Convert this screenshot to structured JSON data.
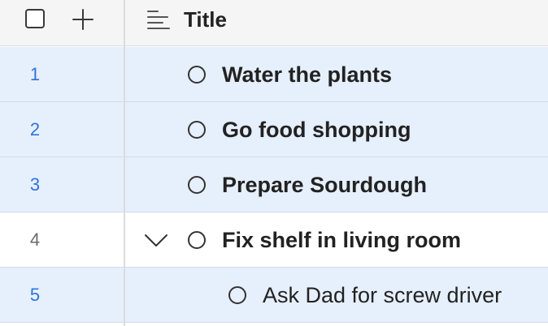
{
  "header": {
    "title": "Title",
    "icons": {
      "select_all": "checkbox-icon",
      "add": "plus-icon",
      "title_field": "text-align-left-icon"
    }
  },
  "rows": [
    {
      "number": "1",
      "title": "Water the plants",
      "selected": true,
      "indent": 0,
      "expandable": false
    },
    {
      "number": "2",
      "title": "Go food shopping",
      "selected": true,
      "indent": 0,
      "expandable": false
    },
    {
      "number": "3",
      "title": "Prepare Sourdough",
      "selected": true,
      "indent": 0,
      "expandable": false
    },
    {
      "number": "4",
      "title": "Fix shelf in living room",
      "selected": false,
      "indent": 0,
      "expandable": true
    },
    {
      "number": "5",
      "title": "Ask Dad for screw driver",
      "selected": true,
      "indent": 1,
      "expandable": false
    }
  ],
  "colors": {
    "selected_row": "#e6effc",
    "selected_number": "#2f73dc",
    "header_bg": "#f5f5f5"
  }
}
